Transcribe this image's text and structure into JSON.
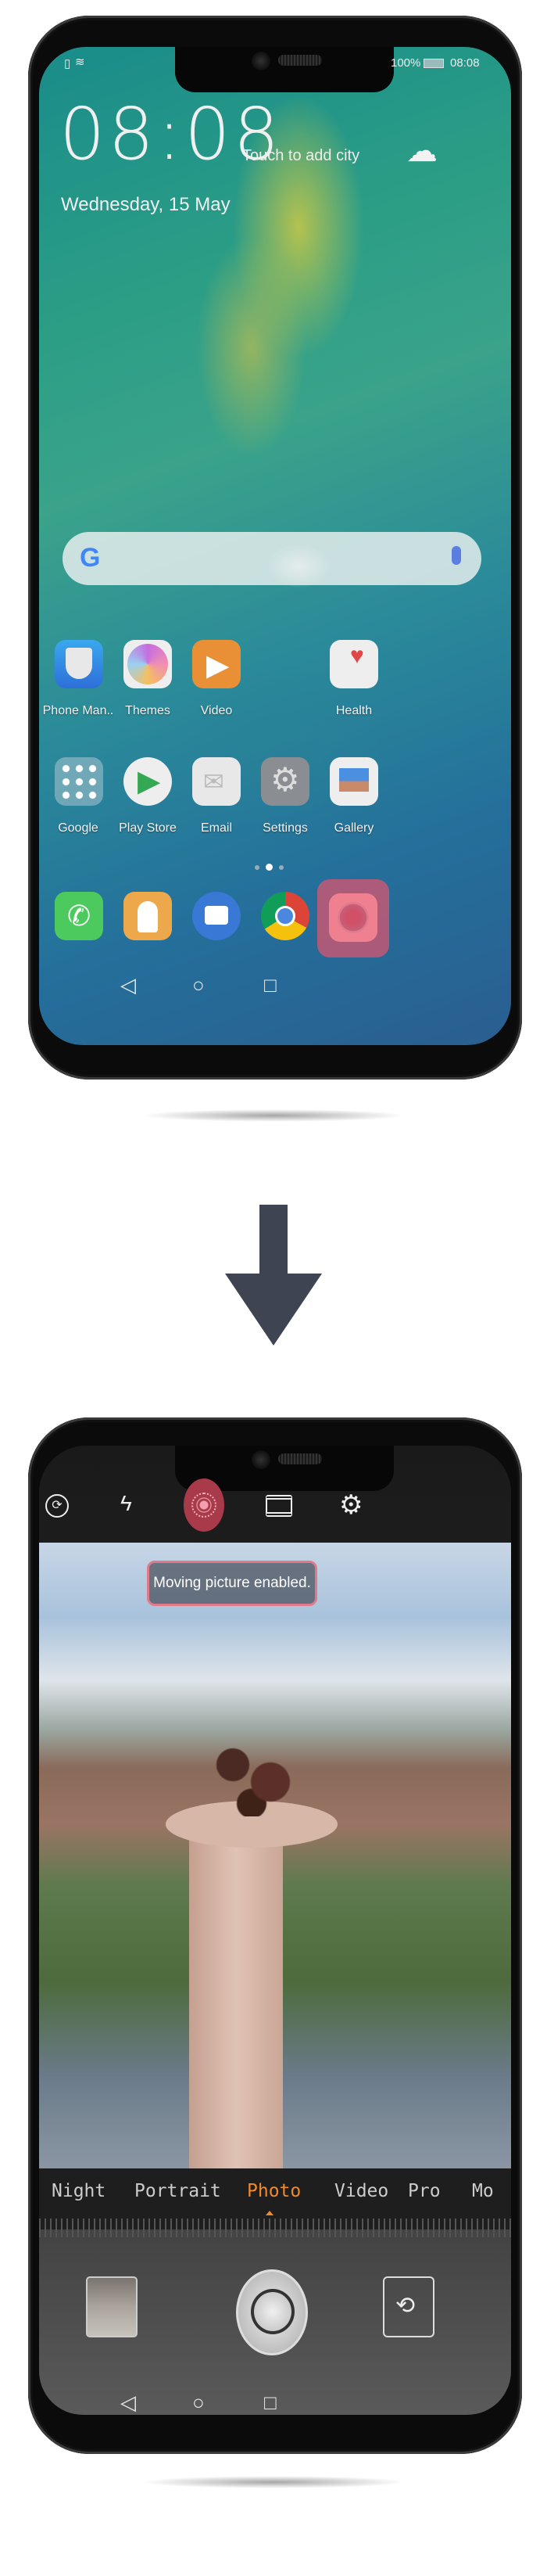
{
  "home": {
    "status": {
      "battery": "100%",
      "time": "08:08"
    },
    "clock": "08:08",
    "weather_hint": "Touch to add city",
    "date": "Wednesday, 15 May",
    "search": {
      "logo": "G",
      "mic_icon": "microphone-icon"
    },
    "apps": [
      {
        "label": "Phone Man..",
        "icon": "shield-icon"
      },
      {
        "label": "Themes",
        "icon": "paintbrush-icon"
      },
      {
        "label": "Video",
        "icon": "play-icon"
      },
      {
        "label": "Health",
        "icon": "heart-icon"
      },
      {
        "label": "Google",
        "icon": "folder-icon"
      },
      {
        "label": "Play Store",
        "icon": "play-store-icon"
      },
      {
        "label": "Email",
        "icon": "envelope-icon"
      },
      {
        "label": "Settings",
        "icon": "gear-icon"
      },
      {
        "label": "Gallery",
        "icon": "picture-icon"
      }
    ],
    "page_indicator": {
      "pages": 3,
      "current": 2
    },
    "dock": [
      "phone-icon",
      "contacts-icon",
      "messages-icon",
      "chrome-icon",
      "camera-icon"
    ],
    "highlight_color": "#d9566f"
  },
  "camera": {
    "toast": "Moving picture enabled.",
    "modes": [
      "Night",
      "Portrait",
      "Photo",
      "Video",
      "Pro",
      "Mo"
    ],
    "active_mode": "Photo",
    "active_color": "#f08a2a",
    "toolbar": [
      "aperture-icon",
      "flash-off-icon",
      "moving-picture-icon",
      "film-icon",
      "gear-icon"
    ]
  }
}
